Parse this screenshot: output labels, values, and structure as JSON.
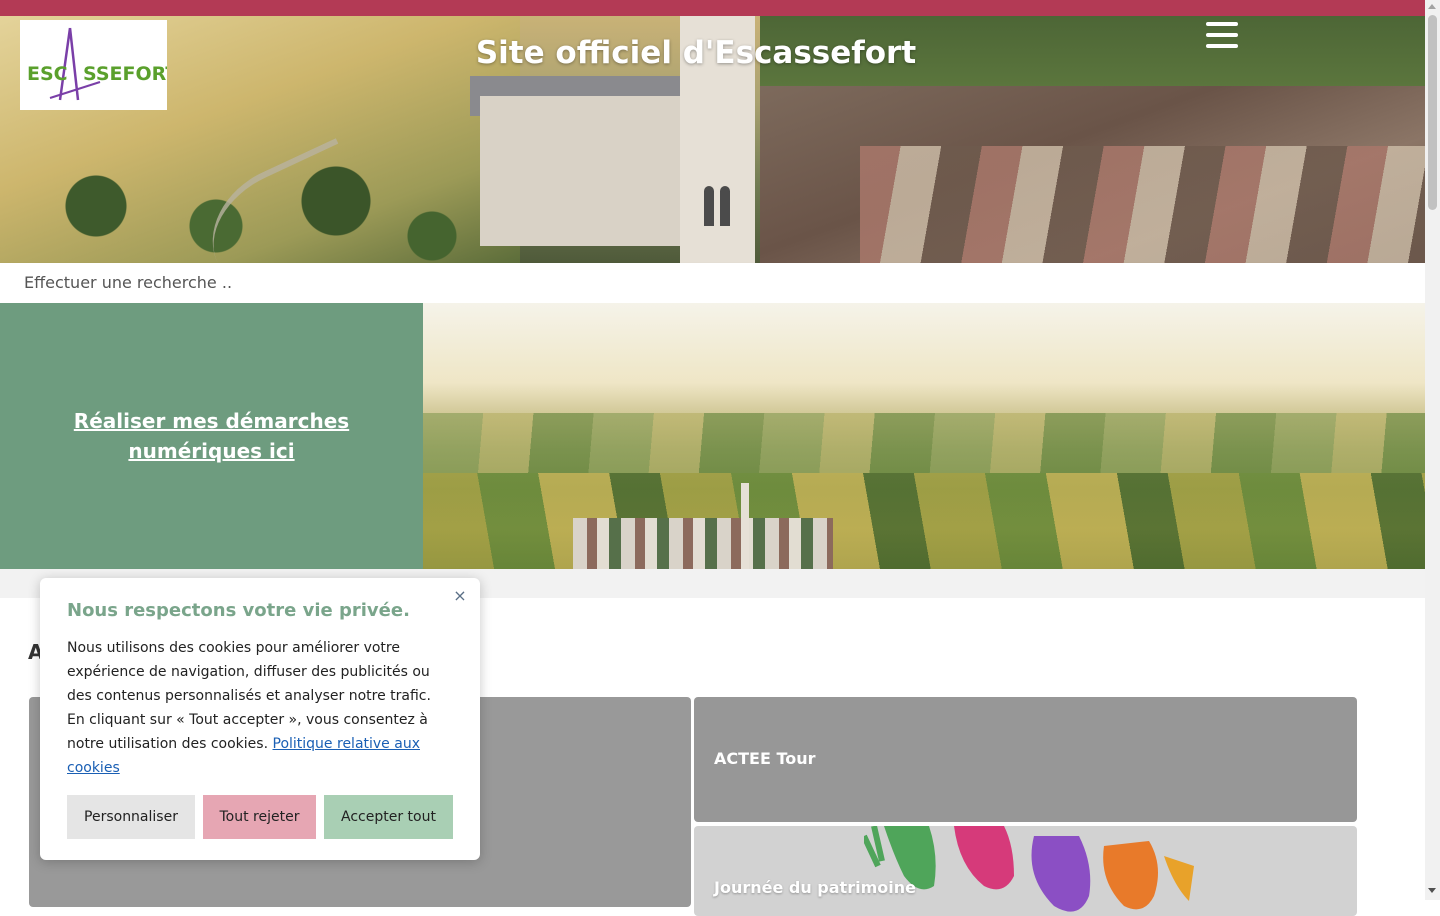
{
  "header": {
    "site_title": "Site officiel d'Escassefort",
    "logo_text": "ESCASSEFORT",
    "menu_icon": "hamburger-menu-icon"
  },
  "search": {
    "placeholder": "Effectuer une recherche .."
  },
  "banner": {
    "link_label": "Réaliser mes démarches numériques ici"
  },
  "news": {
    "section_title_partial": "A",
    "cards": [
      {
        "label": ""
      },
      {
        "label": "ACTEE Tour"
      },
      {
        "label": "Journée du patrimoine"
      }
    ]
  },
  "cookie_banner": {
    "title": "Nous respectons votre vie privée.",
    "body": "Nous utilisons des cookies pour améliorer votre expérience de navigation, diffuser des publicités ou des contenus personnalisés et analyser notre trafic. En cliquant sur « Tout accepter », vous consentez à notre utilisation des cookies.",
    "policy_link": "Politique relative aux cookies",
    "close_symbol": "×",
    "buttons": {
      "customize": "Personnaliser",
      "reject": "Tout rejeter",
      "accept": "Accepter tout"
    }
  },
  "colors": {
    "top_bar": "#b33a55",
    "banner_green": "#6e9c7f",
    "cookie_title": "#7aa58b",
    "reject_button": "#e6a6b3",
    "accept_button": "#a9cfb4",
    "link_blue": "#1a5fb4"
  }
}
